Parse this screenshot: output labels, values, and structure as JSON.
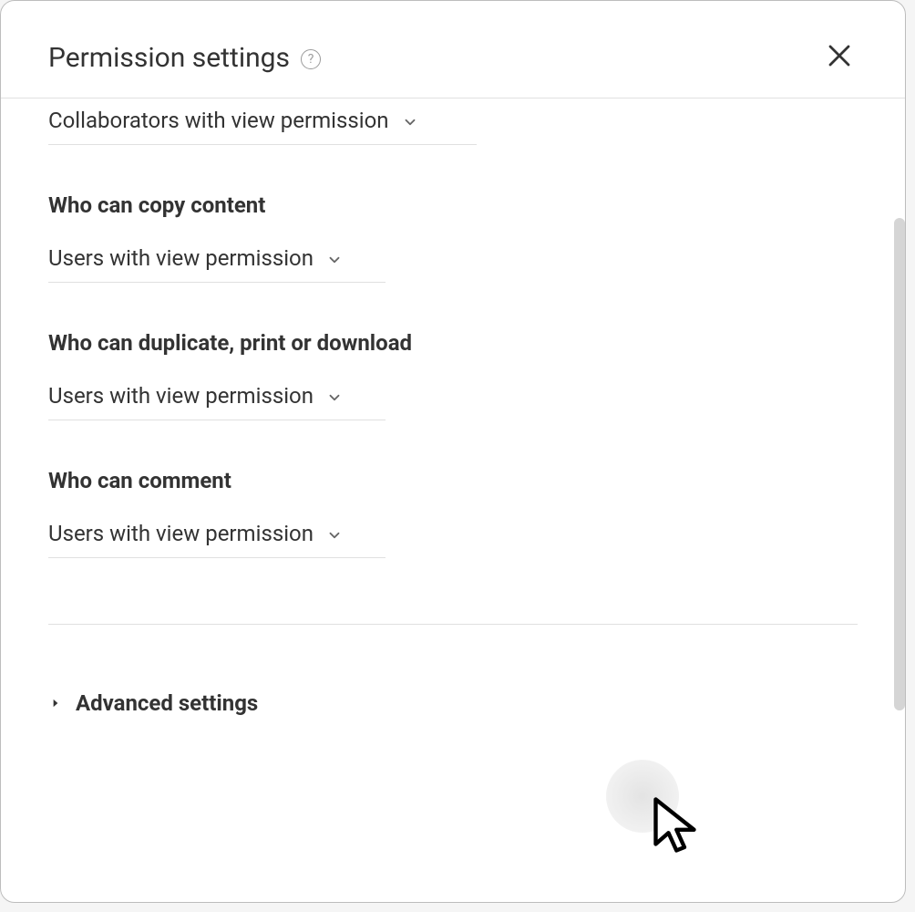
{
  "header": {
    "title": "Permission settings"
  },
  "sections": {
    "s0": {
      "value": "Collaborators with view permission"
    },
    "s1": {
      "title": "Who can copy content",
      "value": "Users with view permission"
    },
    "s2": {
      "title": "Who can duplicate, print or download",
      "value": "Users with view permission"
    },
    "s3": {
      "title": "Who can comment",
      "value": "Users with view permission"
    }
  },
  "advanced": {
    "label": "Advanced settings"
  }
}
